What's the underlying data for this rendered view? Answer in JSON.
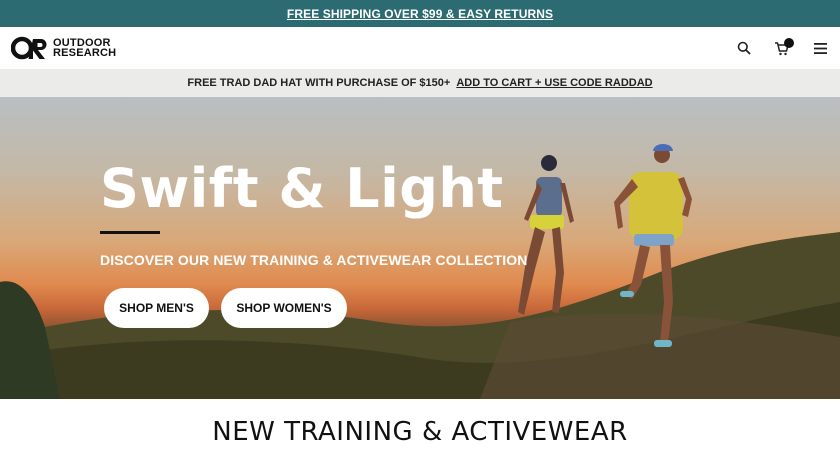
{
  "topbar": {
    "shipping_link": "FREE SHIPPING OVER $99 & EASY RETURNS"
  },
  "header": {
    "logo_line1": "OUTDOOR",
    "logo_line2": "RESEARCH",
    "logo_mark": "OR",
    "icons": [
      "search-icon",
      "cart-icon",
      "menu-icon"
    ]
  },
  "promo": {
    "text": "FREE TRAD DAD HAT WITH PURCHASE OF $150+",
    "link": "ADD TO CART + USE CODE RADDAD"
  },
  "hero": {
    "title": "Swift & Light",
    "subtitle": "DISCOVER OUR NEW TRAINING & ACTIVEWEAR COLLECTION",
    "button_men": "SHOP MEN'S",
    "button_women": "SHOP WOMEN'S"
  },
  "section": {
    "title": "NEW TRAINING & ACTIVEWEAR"
  },
  "colors": {
    "topbar": "#2c6b71",
    "promo_bg": "#ebebea",
    "text": "#111111"
  }
}
